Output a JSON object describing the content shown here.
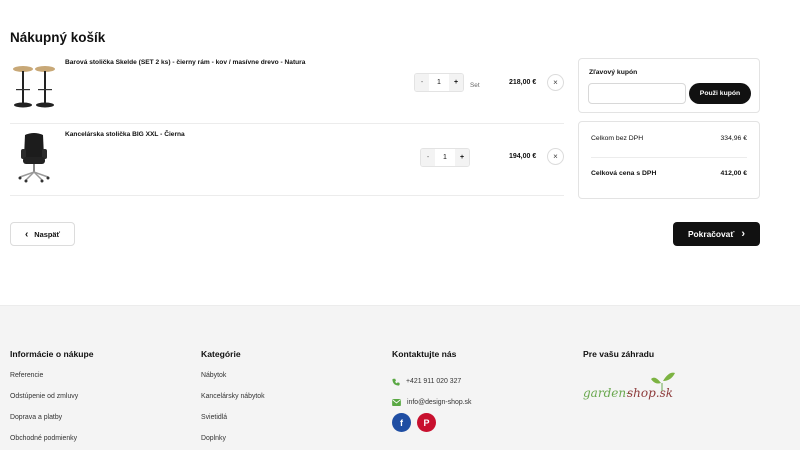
{
  "cart": {
    "title": "Nákupný košík",
    "items": [
      {
        "name": "Barová stolička Skelde (SET 2 ks) - čierny rám - kov / masívne drevo - Natura",
        "qty": "1",
        "unit": "Set",
        "price": "218,00 €",
        "minus": "-",
        "plus": "+",
        "remove": "×"
      },
      {
        "name": "Kancelárska stolička BIG XXL - Čierna",
        "qty": "1",
        "unit": "",
        "price": "194,00 €",
        "minus": "-",
        "plus": "+",
        "remove": "×"
      }
    ]
  },
  "coupon": {
    "label": "Zľavový kupón",
    "placeholder": "",
    "button": "Použi kupón"
  },
  "totals": {
    "subtotal_label": "Celkom bez DPH",
    "subtotal_value": "334,96 €",
    "total_label": "Celková cena s DPH",
    "total_value": "412,00 €"
  },
  "nav": {
    "back": "Naspäť",
    "back_icon": "‹",
    "continue": "Pokračovať",
    "continue_icon": "›"
  },
  "footer": {
    "col1": {
      "title": "Informácie o nákupe",
      "links": [
        "Referencie",
        "Odstúpenie od zmluvy",
        "Doprava a platby",
        "Obchodné podmienky"
      ]
    },
    "col2": {
      "title": "Kategórie",
      "links": [
        "Nábytok",
        "Kancelársky nábytok",
        "Svietidlá",
        "Doplnky"
      ]
    },
    "col3": {
      "title": "Kontaktujte nás",
      "phone": "+421 911 020 327",
      "email": "info@design-shop.sk",
      "social": [
        "f",
        "P"
      ]
    },
    "col4": {
      "title": "Pre vašu záhradu",
      "logo_text": "garden-shop.sk"
    }
  },
  "colors": {
    "accent": "#111111",
    "footer_bg": "#f4f4f4",
    "contact_icon": "#5aa844",
    "facebook": "#1f4ea3",
    "pinterest": "#c8102e"
  }
}
